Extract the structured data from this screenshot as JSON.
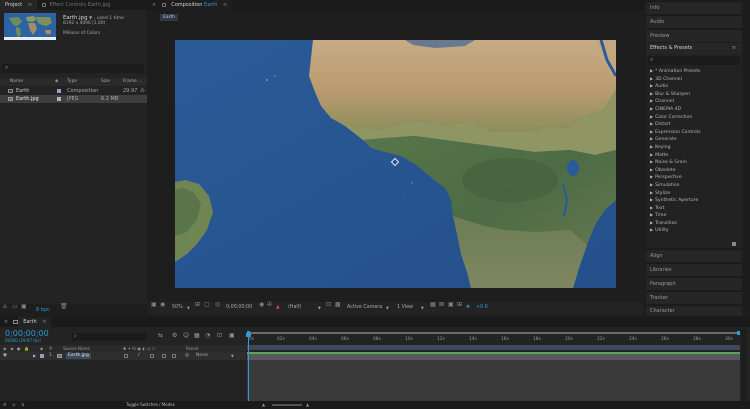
{
  "project_panel": {
    "tabs": [
      {
        "label": "Project",
        "menu": "≡"
      },
      {
        "label": "Effect Controls Earth.jpg"
      }
    ],
    "selected_item": {
      "name": "Earth.jpg",
      "usage": ", used 1 time",
      "dimensions": "8192 x 4096 (1.00)",
      "color_info": "Millions of Colors"
    },
    "search_placeholder": "",
    "columns": [
      "Name",
      "Type",
      "Size",
      "Frame ..."
    ],
    "items": [
      {
        "name": "Earth",
        "type": "Composition",
        "size": "",
        "frame": "29.97"
      },
      {
        "name": "Earth.jpg",
        "type": "JPEG",
        "size": "6.2 MB",
        "frame": ""
      }
    ],
    "footer": {
      "bpc": "8 bpc"
    }
  },
  "composition_panel": {
    "tab_prefix": "Composition",
    "tab_name": "Earth",
    "flow_tab": "Earth",
    "footer": {
      "zoom": "50%",
      "timecode": "0;00;00;00",
      "resolution": "(Half)",
      "camera": "Active Camera",
      "views": "1 View",
      "exposure": "+0.0"
    }
  },
  "right_panels": {
    "top": [
      "Info",
      "Audio",
      "Preview"
    ],
    "effects_title": "Effects & Presets",
    "effects_items": [
      "* Animation Presets",
      "3D Channel",
      "Audio",
      "Blur & Sharpen",
      "Channel",
      "CINEMA 4D",
      "Color Correction",
      "Distort",
      "Expression Controls",
      "Generate",
      "Keying",
      "Matte",
      "Noise & Grain",
      "Obsolete",
      "Perspective",
      "Simulation",
      "Stylize",
      "Synthetic Aperture",
      "Text",
      "Time",
      "Transition",
      "Utility"
    ],
    "bottom": [
      "Align",
      "Libraries",
      "Paragraph",
      "Tracker",
      "Character"
    ]
  },
  "timeline": {
    "tab_name": "Earth",
    "timecode": "0;00;00;00",
    "frame_info": "00000 (29.97 fps)",
    "columns": {
      "name": "Source Name",
      "parent": "Parent"
    },
    "layer": {
      "number": "1",
      "name": "Earth.jpg",
      "parent": "None"
    },
    "ruler": [
      "0s",
      "02s",
      "04s",
      "06s",
      "08s",
      "10s",
      "12s",
      "14s",
      "16s",
      "18s",
      "20s",
      "22s",
      "24s",
      "26s",
      "28s",
      "30s"
    ],
    "toggle_label": "Toggle Switches / Modes"
  },
  "colors": {
    "accent_blue": "#2f9ad6",
    "work_area": "#3b4a5a",
    "layer_bar": "#56585c",
    "layer_green": "#5aa35a"
  }
}
